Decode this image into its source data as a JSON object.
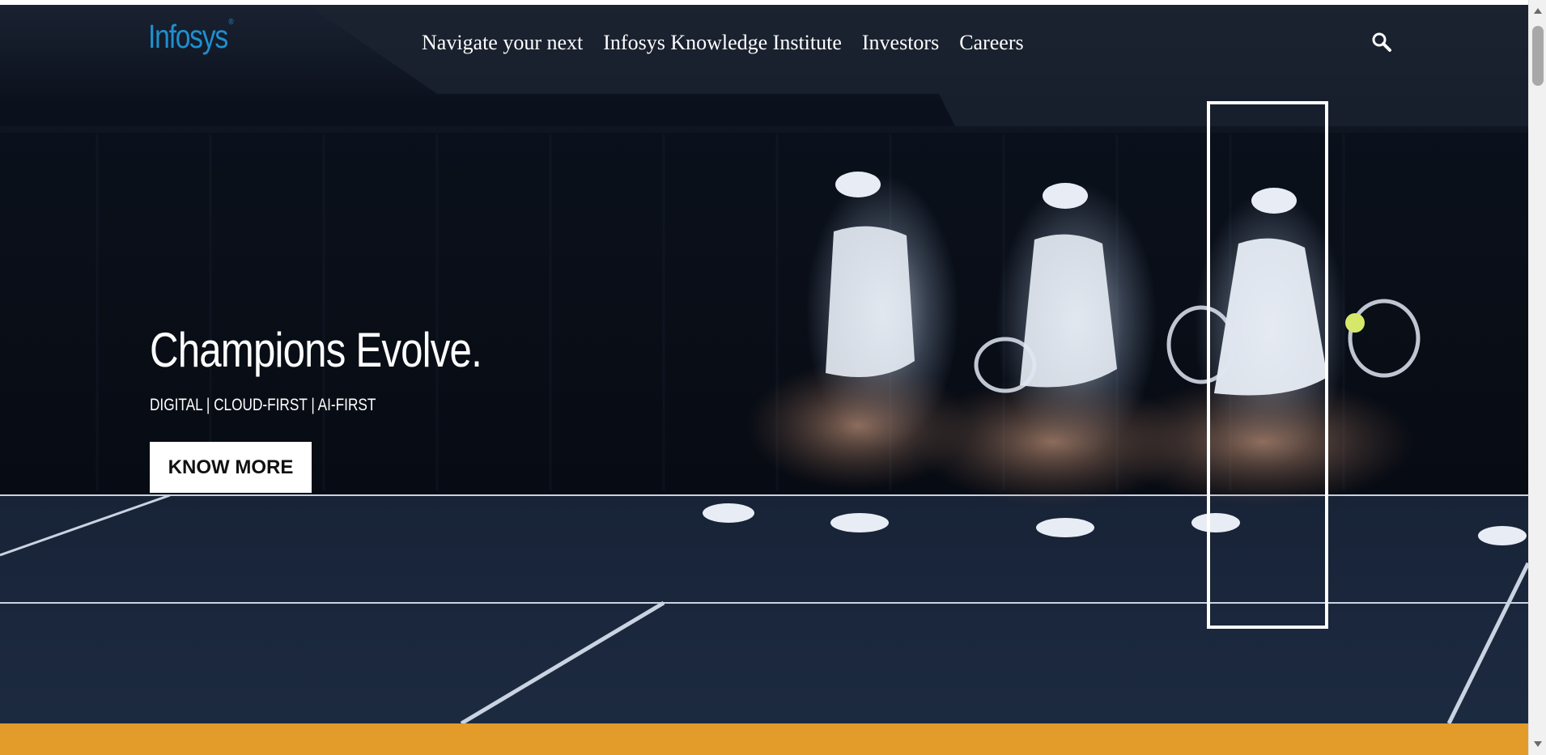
{
  "brand": {
    "logo_text": "Infosys",
    "logo_color": "#1f8fcf"
  },
  "nav": {
    "items": [
      {
        "label": "Navigate your next"
      },
      {
        "label": "Infosys Knowledge Institute"
      },
      {
        "label": "Investors"
      },
      {
        "label": "Careers"
      }
    ],
    "search_icon": "search-icon"
  },
  "hero": {
    "headline": "Champions Evolve.",
    "subline": "DIGITAL | CLOUD-FIRST | AI-FIRST",
    "cta_label": "KNOW MORE"
  },
  "colors": {
    "hero_background": "#0b111c",
    "bottom_bar": "#e39b2a",
    "text": "#ffffff"
  }
}
